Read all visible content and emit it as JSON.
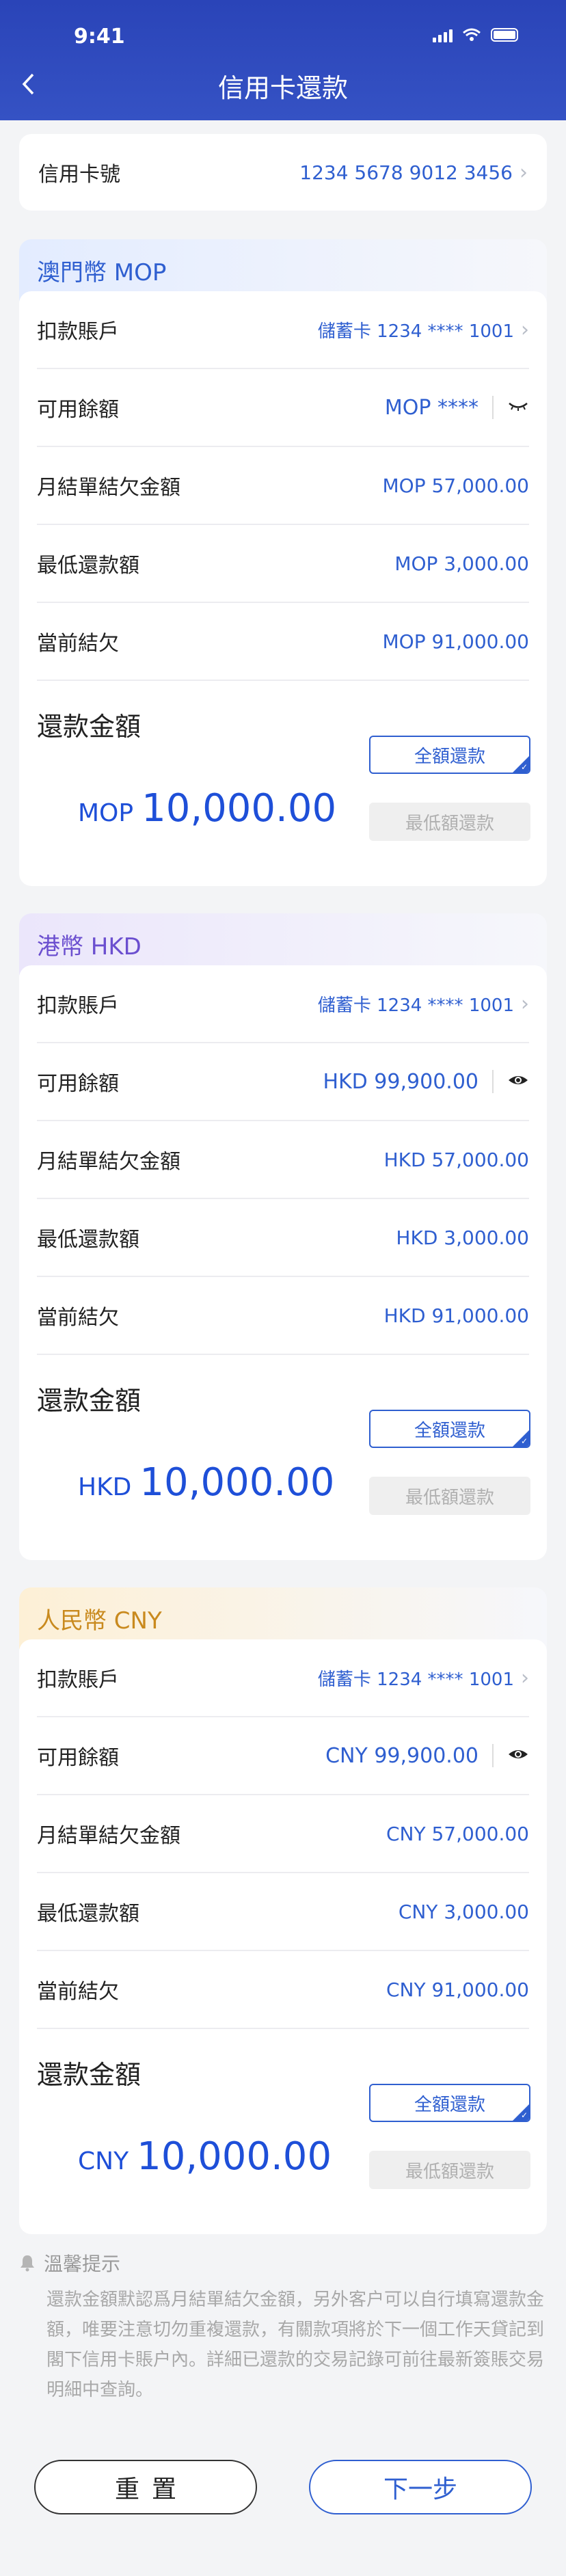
{
  "status": {
    "time": "9:41"
  },
  "header": {
    "title": "信用卡還款"
  },
  "card_number": {
    "label": "信用卡號",
    "value": "1234 5678 9012 3456"
  },
  "labels": {
    "debit_account": "扣款賬戶",
    "available_balance": "可用餘額",
    "statement_balance": "月結單結欠金額",
    "min_payment": "最低還款額",
    "current_balance": "當前結欠",
    "payment_amount": "還款金額",
    "full_payment": "全額還款",
    "min_payment_button": "最低額還款"
  },
  "sections": [
    {
      "title": "澳門幣 MOP",
      "head_color": "#2f5fd0",
      "head_bg": "#e3ecff",
      "debit_account": "儲蓄卡 1234 **** 1001",
      "available_balance": "MOP ****",
      "statement_balance": "MOP 57,000.00",
      "min_payment": "MOP 3,000.00",
      "current_balance": "MOP 91,000.00",
      "amount_currency": "MOP",
      "amount_value": "10,000.00",
      "balance_hidden": true
    },
    {
      "title": "港幣 HKD",
      "head_color": "#6b4fcf",
      "head_bg": "#ebe6fb",
      "debit_account": "儲蓄卡 1234 **** 1001",
      "available_balance": "HKD 99,900.00",
      "statement_balance": "HKD 57,000.00",
      "min_payment": "HKD 3,000.00",
      "current_balance": "HKD 91,000.00",
      "amount_currency": "HKD",
      "amount_value": "10,000.00",
      "balance_hidden": false
    },
    {
      "title": "人民幣 CNY",
      "head_color": "#c98a1e",
      "head_bg": "#fdf0d6",
      "debit_account": "儲蓄卡 1234 **** 1001",
      "available_balance": "CNY 99,900.00",
      "statement_balance": "CNY 57,000.00",
      "min_payment": "CNY 3,000.00",
      "current_balance": "CNY 91,000.00",
      "amount_currency": "CNY",
      "amount_value": "10,000.00",
      "balance_hidden": false
    }
  ],
  "tips": {
    "title": "溫馨提示",
    "text": "還款金額默認爲月結單結欠金額，另外客户可以自行填寫還款金額，唯要注意切勿重複還款，有關款項將於下一個工作天貸記到閣下信用卡賬户內。詳細已還款的交易記錄可前往最新簽賬交易明細中查詢。"
  },
  "buttons": {
    "reset": "重置",
    "next": "下一步"
  }
}
